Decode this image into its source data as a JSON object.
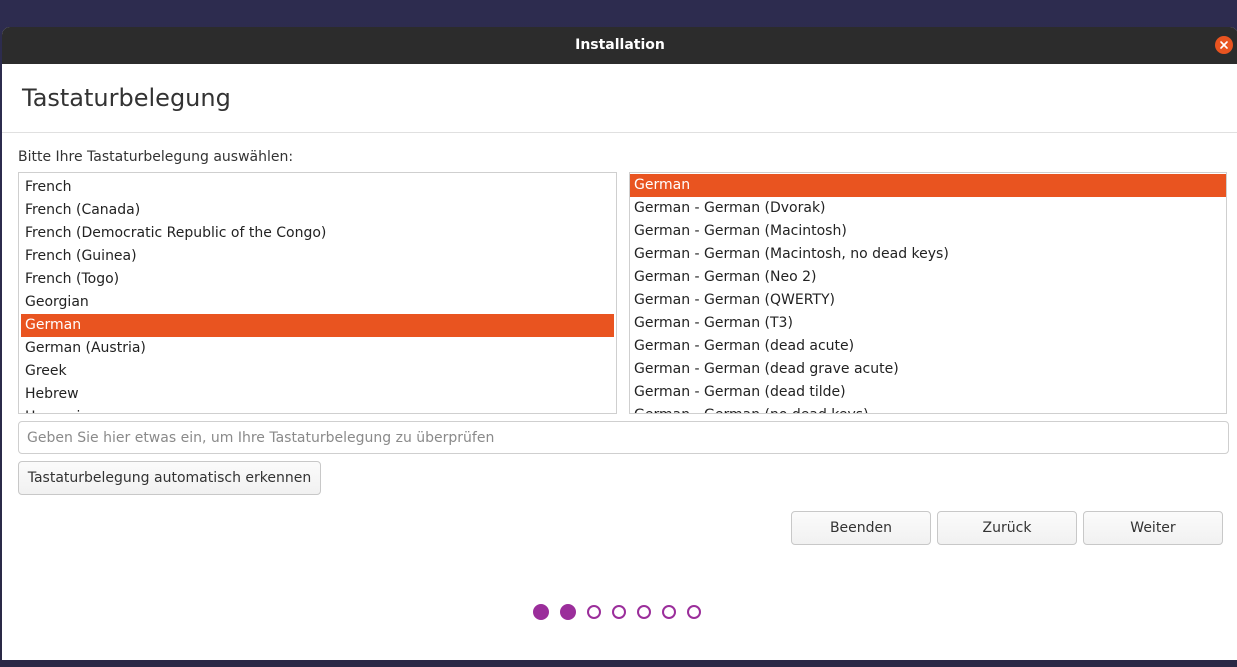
{
  "window": {
    "title": "Installation"
  },
  "page": {
    "title": "Tastaturbelegung",
    "prompt": "Bitte Ihre Tastaturbelegung auswählen:"
  },
  "layouts": [
    {
      "label": "French",
      "selected": false
    },
    {
      "label": "French (Canada)",
      "selected": false
    },
    {
      "label": "French (Democratic Republic of the Congo)",
      "selected": false
    },
    {
      "label": "French (Guinea)",
      "selected": false
    },
    {
      "label": "French (Togo)",
      "selected": false
    },
    {
      "label": "Georgian",
      "selected": false
    },
    {
      "label": "German",
      "selected": true
    },
    {
      "label": "German (Austria)",
      "selected": false
    },
    {
      "label": "Greek",
      "selected": false
    },
    {
      "label": "Hebrew",
      "selected": false
    },
    {
      "label": "Hungarian",
      "selected": false
    }
  ],
  "variants": [
    {
      "label": "German",
      "selected": true
    },
    {
      "label": "German - German (Dvorak)",
      "selected": false
    },
    {
      "label": "German - German (Macintosh)",
      "selected": false
    },
    {
      "label": "German - German (Macintosh, no dead keys)",
      "selected": false
    },
    {
      "label": "German - German (Neo 2)",
      "selected": false
    },
    {
      "label": "German - German (QWERTY)",
      "selected": false
    },
    {
      "label": "German - German (T3)",
      "selected": false
    },
    {
      "label": "German - German (dead acute)",
      "selected": false
    },
    {
      "label": "German - German (dead grave acute)",
      "selected": false
    },
    {
      "label": "German - German (dead tilde)",
      "selected": false
    },
    {
      "label": "German - German (no dead keys)",
      "selected": false
    }
  ],
  "test_input": {
    "value": "",
    "placeholder": "Geben Sie hier etwas ein, um Ihre Tastaturbelegung zu überprüfen"
  },
  "buttons": {
    "detect": "Tastaturbelegung automatisch erkennen",
    "quit": "Beenden",
    "back": "Zurück",
    "next": "Weiter"
  },
  "progress": {
    "total_steps": 7,
    "completed_steps": 2
  },
  "colors": {
    "accent": "#e95420",
    "progress": "#9b2e9b",
    "titlebar": "#2c2c2c"
  }
}
